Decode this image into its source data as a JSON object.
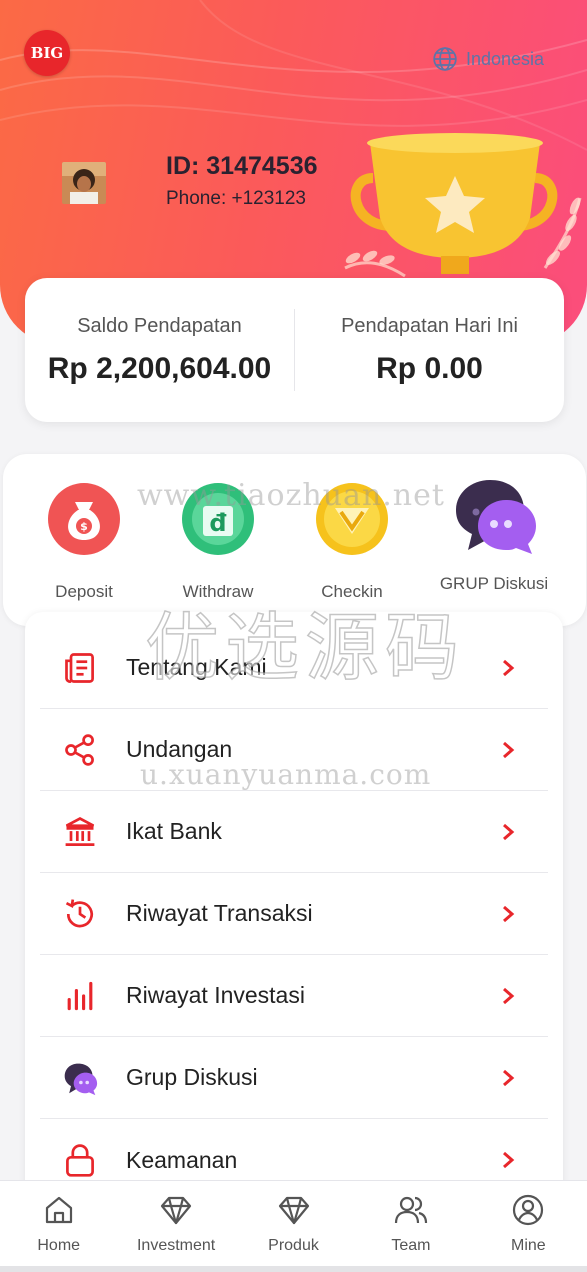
{
  "header": {
    "logo_text": "BIG",
    "language": "Indonesia",
    "user_id": "ID: 31474536",
    "phone": "Phone: +123123"
  },
  "balance": {
    "income_label": "Saldo Pendapatan",
    "income_value": "Rp 2,200,604.00",
    "today_label": "Pendapatan Hari Ini",
    "today_value": "Rp 0.00"
  },
  "quick_actions": [
    {
      "label": "Deposit",
      "icon": "money-bag-icon"
    },
    {
      "label": "Withdraw",
      "icon": "dong-coin-icon"
    },
    {
      "label": "Checkin",
      "icon": "checkin-coin-icon"
    },
    {
      "label": "GRUP Diskusi",
      "icon": "chat-bubbles-icon"
    }
  ],
  "menu": [
    {
      "label": "Tentang Kami",
      "icon": "document-icon"
    },
    {
      "label": "Undangan",
      "icon": "share-icon"
    },
    {
      "label": "Ikat Bank",
      "icon": "bank-icon"
    },
    {
      "label": "Riwayat Transaksi",
      "icon": "history-icon"
    },
    {
      "label": "Riwayat Investasi",
      "icon": "bar-chart-icon"
    },
    {
      "label": "Grup Diskusi",
      "icon": "chat-bubbles-icon"
    },
    {
      "label": "Keamanan",
      "icon": "lock-icon"
    }
  ],
  "watermarks": {
    "line1": "www.tiaozhuan.net",
    "line2": "优选源码",
    "line3": "u.xuanyuanma.com"
  },
  "tabbar": [
    {
      "label": "Home",
      "icon": "home-icon"
    },
    {
      "label": "Investment",
      "icon": "diamond-icon"
    },
    {
      "label": "Produk",
      "icon": "diamond-icon"
    },
    {
      "label": "Team",
      "icon": "team-icon"
    },
    {
      "label": "Mine",
      "icon": "user-circle-icon"
    }
  ],
  "colors": {
    "accent": "#e8262b",
    "header_start": "#fb6a45",
    "header_end": "#fb4d7c",
    "lang_text": "#5d74a8"
  }
}
